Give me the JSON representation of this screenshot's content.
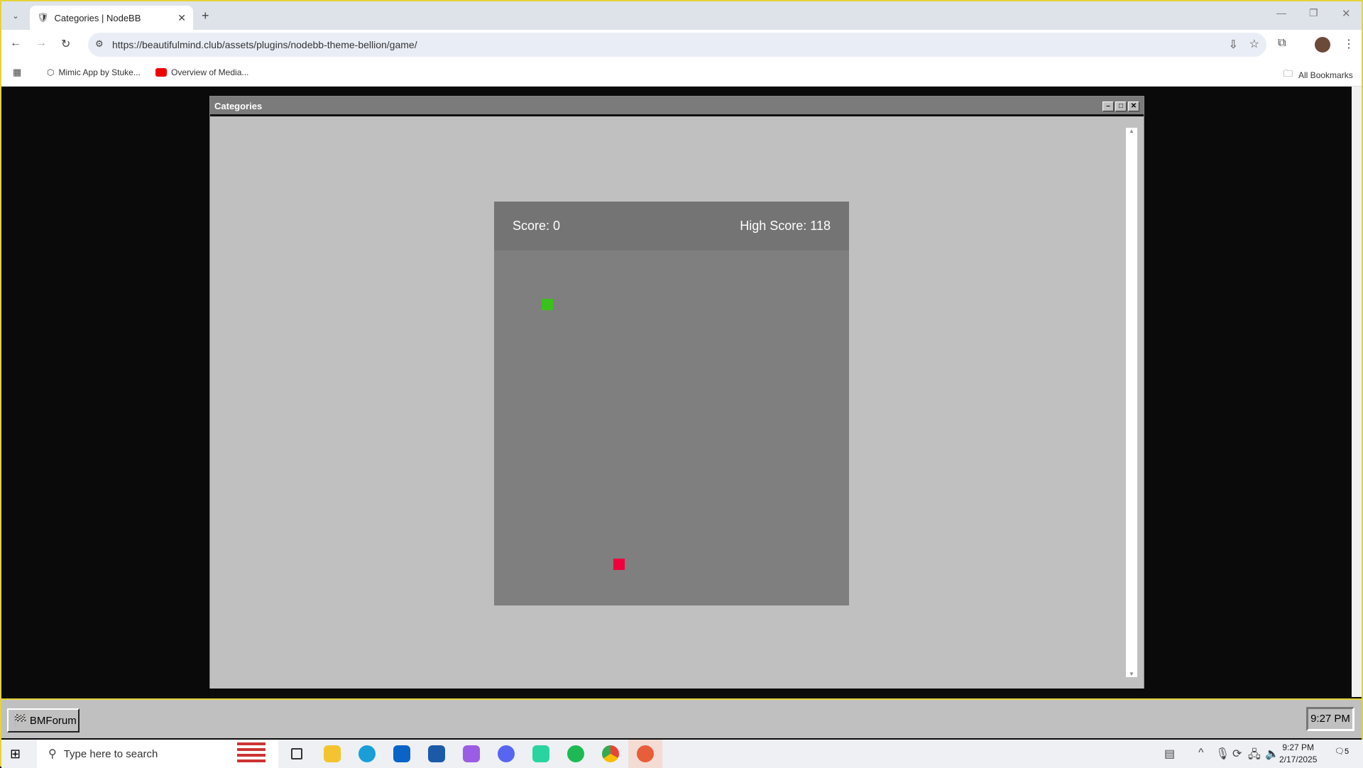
{
  "browser": {
    "tab_title": "Categories | NodeBB",
    "url": "https://beautifulmind.club/assets/plugins/nodebb-theme-bellion/game/",
    "bookmarks": [
      {
        "label": "Mimic App by Stuke..."
      },
      {
        "label": "Overview of Media..."
      }
    ],
    "all_bookmarks": "All Bookmarks"
  },
  "window": {
    "title": "Categories"
  },
  "game": {
    "score": "Score: 0",
    "high_score": "High Score: 118",
    "food_color": "#3cc01e",
    "player_color": "#f0003c"
  },
  "taskbar98": {
    "start_label": "BMForum",
    "clock": "9:27 PM"
  },
  "os": {
    "search_placeholder": "Type here to search",
    "time": "9:27 PM",
    "date": "2/17/2025",
    "notifications": "5"
  }
}
